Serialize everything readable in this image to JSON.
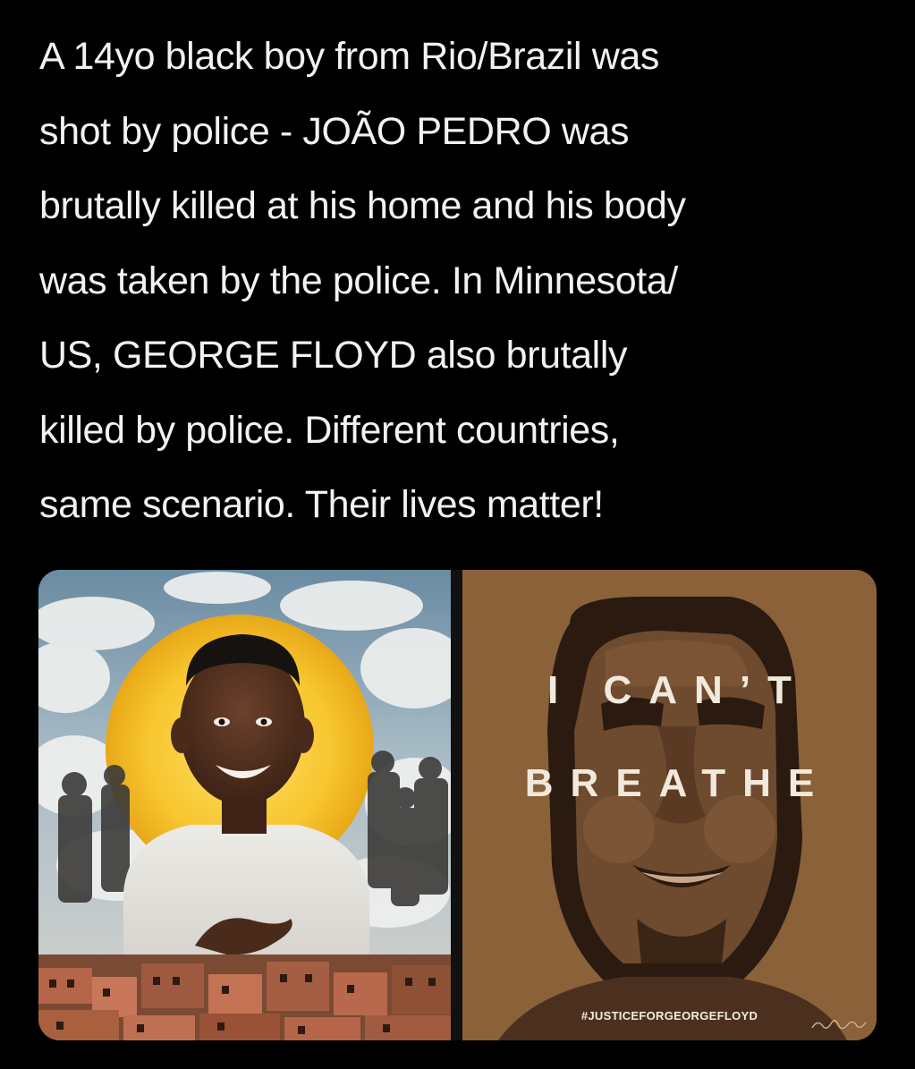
{
  "tweet": {
    "lines": [
      "A 14yo black boy from Rio/Brazil was",
      "shot by police - JOÃO PEDRO was",
      "brutally killed at his home and his body",
      "was taken by the police. In Minnesota/",
      "US, GEORGE FLOYD also brutally",
      "killed by police. Different countries,",
      "same scenario. Their lives matter!"
    ]
  },
  "media": {
    "left": {
      "alt": "Illustration of João Pedro smiling in front of a yellow sun, clouds, riot police and favela houses"
    },
    "right": {
      "caption_line_1": "I CAN’T",
      "caption_line_2": "BREATHE",
      "hashtag": "#JUSTICEFORGEORGEFLOYD",
      "background_color": "#8a6139"
    }
  },
  "colors": {
    "page_background": "#000000",
    "text": "#f2f2f2"
  }
}
